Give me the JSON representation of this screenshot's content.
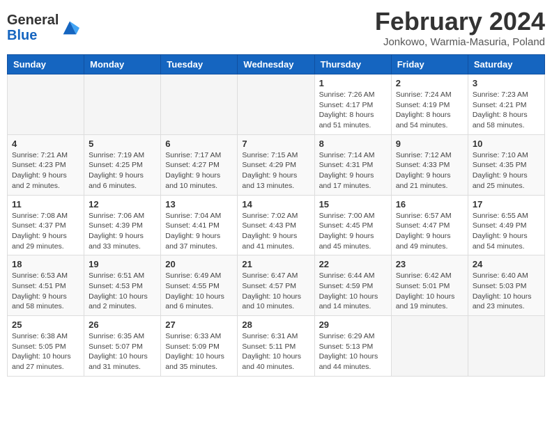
{
  "header": {
    "logo_line1": "General",
    "logo_line2": "Blue",
    "month_year": "February 2024",
    "location": "Jonkowo, Warmia-Masuria, Poland"
  },
  "days_of_week": [
    "Sunday",
    "Monday",
    "Tuesday",
    "Wednesday",
    "Thursday",
    "Friday",
    "Saturday"
  ],
  "weeks": [
    [
      {
        "day": "",
        "info": ""
      },
      {
        "day": "",
        "info": ""
      },
      {
        "day": "",
        "info": ""
      },
      {
        "day": "",
        "info": ""
      },
      {
        "day": "1",
        "info": "Sunrise: 7:26 AM\nSunset: 4:17 PM\nDaylight: 8 hours\nand 51 minutes."
      },
      {
        "day": "2",
        "info": "Sunrise: 7:24 AM\nSunset: 4:19 PM\nDaylight: 8 hours\nand 54 minutes."
      },
      {
        "day": "3",
        "info": "Sunrise: 7:23 AM\nSunset: 4:21 PM\nDaylight: 8 hours\nand 58 minutes."
      }
    ],
    [
      {
        "day": "4",
        "info": "Sunrise: 7:21 AM\nSunset: 4:23 PM\nDaylight: 9 hours\nand 2 minutes."
      },
      {
        "day": "5",
        "info": "Sunrise: 7:19 AM\nSunset: 4:25 PM\nDaylight: 9 hours\nand 6 minutes."
      },
      {
        "day": "6",
        "info": "Sunrise: 7:17 AM\nSunset: 4:27 PM\nDaylight: 9 hours\nand 10 minutes."
      },
      {
        "day": "7",
        "info": "Sunrise: 7:15 AM\nSunset: 4:29 PM\nDaylight: 9 hours\nand 13 minutes."
      },
      {
        "day": "8",
        "info": "Sunrise: 7:14 AM\nSunset: 4:31 PM\nDaylight: 9 hours\nand 17 minutes."
      },
      {
        "day": "9",
        "info": "Sunrise: 7:12 AM\nSunset: 4:33 PM\nDaylight: 9 hours\nand 21 minutes."
      },
      {
        "day": "10",
        "info": "Sunrise: 7:10 AM\nSunset: 4:35 PM\nDaylight: 9 hours\nand 25 minutes."
      }
    ],
    [
      {
        "day": "11",
        "info": "Sunrise: 7:08 AM\nSunset: 4:37 PM\nDaylight: 9 hours\nand 29 minutes."
      },
      {
        "day": "12",
        "info": "Sunrise: 7:06 AM\nSunset: 4:39 PM\nDaylight: 9 hours\nand 33 minutes."
      },
      {
        "day": "13",
        "info": "Sunrise: 7:04 AM\nSunset: 4:41 PM\nDaylight: 9 hours\nand 37 minutes."
      },
      {
        "day": "14",
        "info": "Sunrise: 7:02 AM\nSunset: 4:43 PM\nDaylight: 9 hours\nand 41 minutes."
      },
      {
        "day": "15",
        "info": "Sunrise: 7:00 AM\nSunset: 4:45 PM\nDaylight: 9 hours\nand 45 minutes."
      },
      {
        "day": "16",
        "info": "Sunrise: 6:57 AM\nSunset: 4:47 PM\nDaylight: 9 hours\nand 49 minutes."
      },
      {
        "day": "17",
        "info": "Sunrise: 6:55 AM\nSunset: 4:49 PM\nDaylight: 9 hours\nand 54 minutes."
      }
    ],
    [
      {
        "day": "18",
        "info": "Sunrise: 6:53 AM\nSunset: 4:51 PM\nDaylight: 9 hours\nand 58 minutes."
      },
      {
        "day": "19",
        "info": "Sunrise: 6:51 AM\nSunset: 4:53 PM\nDaylight: 10 hours\nand 2 minutes."
      },
      {
        "day": "20",
        "info": "Sunrise: 6:49 AM\nSunset: 4:55 PM\nDaylight: 10 hours\nand 6 minutes."
      },
      {
        "day": "21",
        "info": "Sunrise: 6:47 AM\nSunset: 4:57 PM\nDaylight: 10 hours\nand 10 minutes."
      },
      {
        "day": "22",
        "info": "Sunrise: 6:44 AM\nSunset: 4:59 PM\nDaylight: 10 hours\nand 14 minutes."
      },
      {
        "day": "23",
        "info": "Sunrise: 6:42 AM\nSunset: 5:01 PM\nDaylight: 10 hours\nand 19 minutes."
      },
      {
        "day": "24",
        "info": "Sunrise: 6:40 AM\nSunset: 5:03 PM\nDaylight: 10 hours\nand 23 minutes."
      }
    ],
    [
      {
        "day": "25",
        "info": "Sunrise: 6:38 AM\nSunset: 5:05 PM\nDaylight: 10 hours\nand 27 minutes."
      },
      {
        "day": "26",
        "info": "Sunrise: 6:35 AM\nSunset: 5:07 PM\nDaylight: 10 hours\nand 31 minutes."
      },
      {
        "day": "27",
        "info": "Sunrise: 6:33 AM\nSunset: 5:09 PM\nDaylight: 10 hours\nand 35 minutes."
      },
      {
        "day": "28",
        "info": "Sunrise: 6:31 AM\nSunset: 5:11 PM\nDaylight: 10 hours\nand 40 minutes."
      },
      {
        "day": "29",
        "info": "Sunrise: 6:29 AM\nSunset: 5:13 PM\nDaylight: 10 hours\nand 44 minutes."
      },
      {
        "day": "",
        "info": ""
      },
      {
        "day": "",
        "info": ""
      }
    ]
  ]
}
